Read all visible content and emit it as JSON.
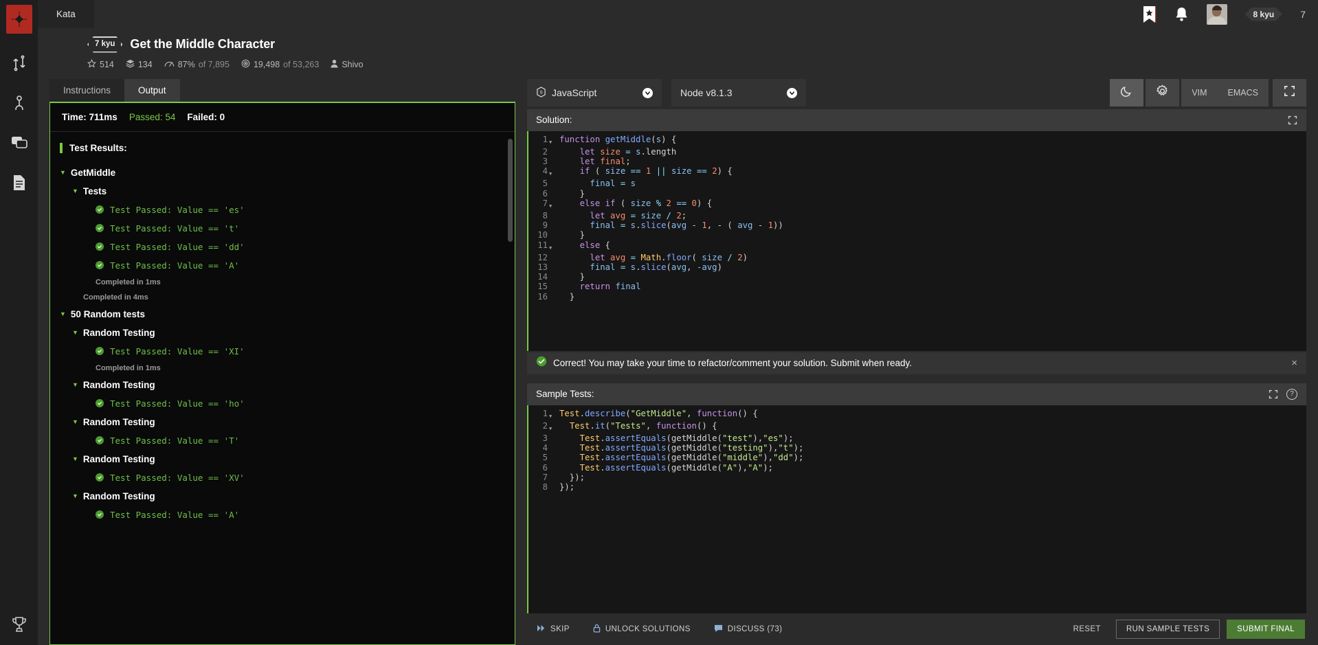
{
  "rail": {
    "logo": "codewars-logo",
    "icons": [
      {
        "name": "kata-icon",
        "label": "Kata"
      },
      {
        "name": "kumite-icon",
        "label": "Kumite"
      },
      {
        "name": "discussion-icon",
        "label": "Discussions"
      },
      {
        "name": "docs-icon",
        "label": "Docs"
      }
    ],
    "bottom_icon": {
      "name": "trophy-icon",
      "label": "Leaderboards"
    }
  },
  "topbar": {
    "tab_label": "Kata",
    "bookmark_icon": "bookmark-icon",
    "notification_icon": "bell-icon",
    "avatar": "user-avatar",
    "rank_badge": "8 kyu",
    "honor": "7"
  },
  "kata": {
    "rank": "7 kyu",
    "title": "Get the Middle Character",
    "stats": {
      "stars": "514",
      "satisfaction_layers": "134",
      "percent_label": "87%",
      "percent_of": "of 7,895",
      "completed": "19,498",
      "completed_of": "of 53,263",
      "author": "Shivo"
    }
  },
  "tabs": [
    {
      "label": "Instructions",
      "active": false
    },
    {
      "label": "Output",
      "active": true
    }
  ],
  "output": {
    "time_label": "Time: 711ms",
    "passed_label": "Passed: 54",
    "failed_label": "Failed: 0",
    "results_title": "Test Results:",
    "nodes": [
      {
        "type": "group",
        "indent": 0,
        "label": "GetMiddle"
      },
      {
        "type": "group",
        "indent": 1,
        "label": "Tests"
      },
      {
        "type": "test",
        "indent": 2,
        "text": "Test Passed: Value == 'es'"
      },
      {
        "type": "test",
        "indent": 2,
        "text": "Test Passed: Value == 't'"
      },
      {
        "type": "test",
        "indent": 2,
        "text": "Test Passed: Value == 'dd'"
      },
      {
        "type": "test",
        "indent": 2,
        "text": "Test Passed: Value == 'A'"
      },
      {
        "type": "completed",
        "indent": 2,
        "text": "Completed in 1ms"
      },
      {
        "type": "completed",
        "indent": 1,
        "text": "Completed in 4ms"
      },
      {
        "type": "group",
        "indent": 0,
        "label": "50 Random tests"
      },
      {
        "type": "group",
        "indent": 1,
        "label": "Random Testing"
      },
      {
        "type": "test",
        "indent": 2,
        "text": "Test Passed: Value == 'XI'"
      },
      {
        "type": "completed",
        "indent": 2,
        "text": "Completed in 1ms"
      },
      {
        "type": "group",
        "indent": 1,
        "label": "Random Testing"
      },
      {
        "type": "test",
        "indent": 2,
        "text": "Test Passed: Value == 'ho'"
      },
      {
        "type": "group",
        "indent": 1,
        "label": "Random Testing"
      },
      {
        "type": "test",
        "indent": 2,
        "text": "Test Passed: Value == 'T'"
      },
      {
        "type": "group",
        "indent": 1,
        "label": "Random Testing"
      },
      {
        "type": "test",
        "indent": 2,
        "text": "Test Passed: Value == 'XV'"
      },
      {
        "type": "group",
        "indent": 1,
        "label": "Random Testing"
      },
      {
        "type": "test",
        "indent": 2,
        "text": "Test Passed: Value == 'A'"
      }
    ]
  },
  "editor_toolbar": {
    "language": "JavaScript",
    "language_icon": "javascript-icon",
    "runtime": "Node v8.1.3",
    "theme_dark_icon": "moon-icon",
    "theme_light_icon": "sun-icon",
    "keymap_vim": "VIM",
    "keymap_emacs": "EMACS",
    "fullscreen_icon": "expand-icon"
  },
  "solution": {
    "title": "Solution:",
    "expand_icon": "expand-icon",
    "lines": [
      {
        "n": "1",
        "fold": true,
        "segments": [
          {
            "t": "function ",
            "c": "k"
          },
          {
            "t": "getMiddle",
            "c": "fn"
          },
          {
            "t": "(",
            "c": "pn"
          },
          {
            "t": "s",
            "c": "pm"
          },
          {
            "t": ") {",
            "c": "pn"
          }
        ]
      },
      {
        "n": "2",
        "fold": false,
        "segments": [
          {
            "t": "    ",
            "c": "pn"
          },
          {
            "t": "let ",
            "c": "k"
          },
          {
            "t": "size",
            "c": "vr"
          },
          {
            "t": " = ",
            "c": "op"
          },
          {
            "t": "s",
            "c": "pm"
          },
          {
            "t": ".length",
            "c": "pn"
          }
        ]
      },
      {
        "n": "3",
        "fold": false,
        "segments": [
          {
            "t": "    ",
            "c": "pn"
          },
          {
            "t": "let ",
            "c": "k"
          },
          {
            "t": "final",
            "c": "vr"
          },
          {
            "t": ";",
            "c": "pn"
          }
        ]
      },
      {
        "n": "4",
        "fold": true,
        "segments": [
          {
            "t": "    ",
            "c": "pn"
          },
          {
            "t": "if",
            "c": "k"
          },
          {
            "t": " ( ",
            "c": "pn"
          },
          {
            "t": "size",
            "c": "pm"
          },
          {
            "t": " == ",
            "c": "op"
          },
          {
            "t": "1",
            "c": "nm"
          },
          {
            "t": " || ",
            "c": "op"
          },
          {
            "t": "size",
            "c": "pm"
          },
          {
            "t": " == ",
            "c": "op"
          },
          {
            "t": "2",
            "c": "nm"
          },
          {
            "t": ") {",
            "c": "pn"
          }
        ]
      },
      {
        "n": "5",
        "fold": false,
        "segments": [
          {
            "t": "      ",
            "c": "pn"
          },
          {
            "t": "final",
            "c": "pm"
          },
          {
            "t": " = ",
            "c": "op"
          },
          {
            "t": "s",
            "c": "pm"
          }
        ]
      },
      {
        "n": "6",
        "fold": false,
        "segments": [
          {
            "t": "    }",
            "c": "pn"
          }
        ]
      },
      {
        "n": "7",
        "fold": true,
        "segments": [
          {
            "t": "    ",
            "c": "pn"
          },
          {
            "t": "else if",
            "c": "k"
          },
          {
            "t": " ( ",
            "c": "pn"
          },
          {
            "t": "size",
            "c": "pm"
          },
          {
            "t": " % ",
            "c": "op"
          },
          {
            "t": "2",
            "c": "nm"
          },
          {
            "t": " == ",
            "c": "op"
          },
          {
            "t": "0",
            "c": "nm"
          },
          {
            "t": ") {",
            "c": "pn"
          }
        ]
      },
      {
        "n": "8",
        "fold": false,
        "segments": [
          {
            "t": "      ",
            "c": "pn"
          },
          {
            "t": "let ",
            "c": "k"
          },
          {
            "t": "avg",
            "c": "vr"
          },
          {
            "t": " = ",
            "c": "op"
          },
          {
            "t": "size",
            "c": "pm"
          },
          {
            "t": " / ",
            "c": "op"
          },
          {
            "t": "2",
            "c": "nm"
          },
          {
            "t": ";",
            "c": "pn"
          }
        ]
      },
      {
        "n": "9",
        "fold": false,
        "segments": [
          {
            "t": "      ",
            "c": "pn"
          },
          {
            "t": "final",
            "c": "pm"
          },
          {
            "t": " = ",
            "c": "op"
          },
          {
            "t": "s",
            "c": "pm"
          },
          {
            "t": ".",
            "c": "pn"
          },
          {
            "t": "slice",
            "c": "mt"
          },
          {
            "t": "(",
            "c": "pn"
          },
          {
            "t": "avg",
            "c": "pm"
          },
          {
            "t": " - ",
            "c": "op"
          },
          {
            "t": "1",
            "c": "nm"
          },
          {
            "t": ", - ( ",
            "c": "pn"
          },
          {
            "t": "avg",
            "c": "pm"
          },
          {
            "t": " - ",
            "c": "op"
          },
          {
            "t": "1",
            "c": "nm"
          },
          {
            "t": "))",
            "c": "pn"
          }
        ]
      },
      {
        "n": "10",
        "fold": false,
        "segments": [
          {
            "t": "    }",
            "c": "pn"
          }
        ]
      },
      {
        "n": "11",
        "fold": true,
        "segments": [
          {
            "t": "    ",
            "c": "pn"
          },
          {
            "t": "else",
            "c": "k"
          },
          {
            "t": " {",
            "c": "pn"
          }
        ]
      },
      {
        "n": "12",
        "fold": false,
        "segments": [
          {
            "t": "      ",
            "c": "pn"
          },
          {
            "t": "let ",
            "c": "k"
          },
          {
            "t": "avg",
            "c": "vr"
          },
          {
            "t": " = ",
            "c": "op"
          },
          {
            "t": "Math",
            "c": "ob"
          },
          {
            "t": ".",
            "c": "pn"
          },
          {
            "t": "floor",
            "c": "mt"
          },
          {
            "t": "( ",
            "c": "pn"
          },
          {
            "t": "size",
            "c": "pm"
          },
          {
            "t": " / ",
            "c": "op"
          },
          {
            "t": "2",
            "c": "nm"
          },
          {
            "t": ")",
            "c": "pn"
          }
        ]
      },
      {
        "n": "13",
        "fold": false,
        "segments": [
          {
            "t": "      ",
            "c": "pn"
          },
          {
            "t": "final",
            "c": "pm"
          },
          {
            "t": " = ",
            "c": "op"
          },
          {
            "t": "s",
            "c": "pm"
          },
          {
            "t": ".",
            "c": "pn"
          },
          {
            "t": "slice",
            "c": "mt"
          },
          {
            "t": "(",
            "c": "pn"
          },
          {
            "t": "avg",
            "c": "pm"
          },
          {
            "t": ", ",
            "c": "pn"
          },
          {
            "t": "-avg",
            "c": "pm"
          },
          {
            "t": ")",
            "c": "pn"
          }
        ]
      },
      {
        "n": "14",
        "fold": false,
        "segments": [
          {
            "t": "    }",
            "c": "pn"
          }
        ]
      },
      {
        "n": "15",
        "fold": false,
        "segments": [
          {
            "t": "    ",
            "c": "pn"
          },
          {
            "t": "return",
            "c": "k"
          },
          {
            "t": " ",
            "c": "pn"
          },
          {
            "t": "final",
            "c": "pm"
          }
        ]
      },
      {
        "n": "16",
        "fold": false,
        "segments": [
          {
            "t": "  }",
            "c": "pn"
          }
        ]
      }
    ]
  },
  "banner": {
    "icon": "success-check-icon",
    "text": "Correct! You may take your time to refactor/comment your solution. Submit when ready.",
    "close": "×"
  },
  "sample_tests": {
    "title": "Sample Tests:",
    "expand_icon": "expand-icon",
    "help_icon": "?",
    "lines": [
      {
        "n": "1",
        "fold": true,
        "segments": [
          {
            "t": "Test",
            "c": "ob"
          },
          {
            "t": ".",
            "c": "pn"
          },
          {
            "t": "describe",
            "c": "mt"
          },
          {
            "t": "(",
            "c": "pn"
          },
          {
            "t": "\"GetMiddle\"",
            "c": "st"
          },
          {
            "t": ", ",
            "c": "pn"
          },
          {
            "t": "function",
            "c": "k"
          },
          {
            "t": "() {",
            "c": "pn"
          }
        ]
      },
      {
        "n": "2",
        "fold": true,
        "segments": [
          {
            "t": "  ",
            "c": "pn"
          },
          {
            "t": "Test",
            "c": "ob"
          },
          {
            "t": ".",
            "c": "pn"
          },
          {
            "t": "it",
            "c": "mt"
          },
          {
            "t": "(",
            "c": "pn"
          },
          {
            "t": "\"Tests\"",
            "c": "st"
          },
          {
            "t": ", ",
            "c": "pn"
          },
          {
            "t": "function",
            "c": "k"
          },
          {
            "t": "() {",
            "c": "pn"
          }
        ]
      },
      {
        "n": "3",
        "fold": false,
        "segments": [
          {
            "t": "    ",
            "c": "pn"
          },
          {
            "t": "Test",
            "c": "ob"
          },
          {
            "t": ".",
            "c": "pn"
          },
          {
            "t": "assertEquals",
            "c": "mt"
          },
          {
            "t": "(",
            "c": "pn"
          },
          {
            "t": "getMiddle",
            "c": "pn"
          },
          {
            "t": "(",
            "c": "pn"
          },
          {
            "t": "\"test\"",
            "c": "st"
          },
          {
            "t": "),",
            "c": "pn"
          },
          {
            "t": "\"es\"",
            "c": "st"
          },
          {
            "t": ");",
            "c": "pn"
          }
        ]
      },
      {
        "n": "4",
        "fold": false,
        "segments": [
          {
            "t": "    ",
            "c": "pn"
          },
          {
            "t": "Test",
            "c": "ob"
          },
          {
            "t": ".",
            "c": "pn"
          },
          {
            "t": "assertEquals",
            "c": "mt"
          },
          {
            "t": "(",
            "c": "pn"
          },
          {
            "t": "getMiddle",
            "c": "pn"
          },
          {
            "t": "(",
            "c": "pn"
          },
          {
            "t": "\"testing\"",
            "c": "st"
          },
          {
            "t": "),",
            "c": "pn"
          },
          {
            "t": "\"t\"",
            "c": "st"
          },
          {
            "t": ");",
            "c": "pn"
          }
        ]
      },
      {
        "n": "5",
        "fold": false,
        "segments": [
          {
            "t": "    ",
            "c": "pn"
          },
          {
            "t": "Test",
            "c": "ob"
          },
          {
            "t": ".",
            "c": "pn"
          },
          {
            "t": "assertEquals",
            "c": "mt"
          },
          {
            "t": "(",
            "c": "pn"
          },
          {
            "t": "getMiddle",
            "c": "pn"
          },
          {
            "t": "(",
            "c": "pn"
          },
          {
            "t": "\"middle\"",
            "c": "st"
          },
          {
            "t": "),",
            "c": "pn"
          },
          {
            "t": "\"dd\"",
            "c": "st"
          },
          {
            "t": ");",
            "c": "pn"
          }
        ]
      },
      {
        "n": "6",
        "fold": false,
        "segments": [
          {
            "t": "    ",
            "c": "pn"
          },
          {
            "t": "Test",
            "c": "ob"
          },
          {
            "t": ".",
            "c": "pn"
          },
          {
            "t": "assertEquals",
            "c": "mt"
          },
          {
            "t": "(",
            "c": "pn"
          },
          {
            "t": "getMiddle",
            "c": "pn"
          },
          {
            "t": "(",
            "c": "pn"
          },
          {
            "t": "\"A\"",
            "c": "st"
          },
          {
            "t": "),",
            "c": "pn"
          },
          {
            "t": "\"A\"",
            "c": "st"
          },
          {
            "t": ");",
            "c": "pn"
          }
        ]
      },
      {
        "n": "7",
        "fold": false,
        "segments": [
          {
            "t": "  });",
            "c": "pn"
          }
        ]
      },
      {
        "n": "8",
        "fold": false,
        "segments": [
          {
            "t": "});",
            "c": "pn"
          }
        ]
      }
    ]
  },
  "actions": {
    "skip": "SKIP",
    "skip_icon": "fast-forward-icon",
    "unlock": "UNLOCK SOLUTIONS",
    "unlock_icon": "lock-icon",
    "discuss": "DISCUSS (73)",
    "discuss_icon": "comment-icon",
    "reset": "RESET",
    "run_sample": "RUN SAMPLE TESTS",
    "submit": "SUBMIT FINAL"
  },
  "colors": {
    "accent_green": "#7ac943",
    "brand_red": "#b02a22",
    "panel_bg": "#161616"
  }
}
